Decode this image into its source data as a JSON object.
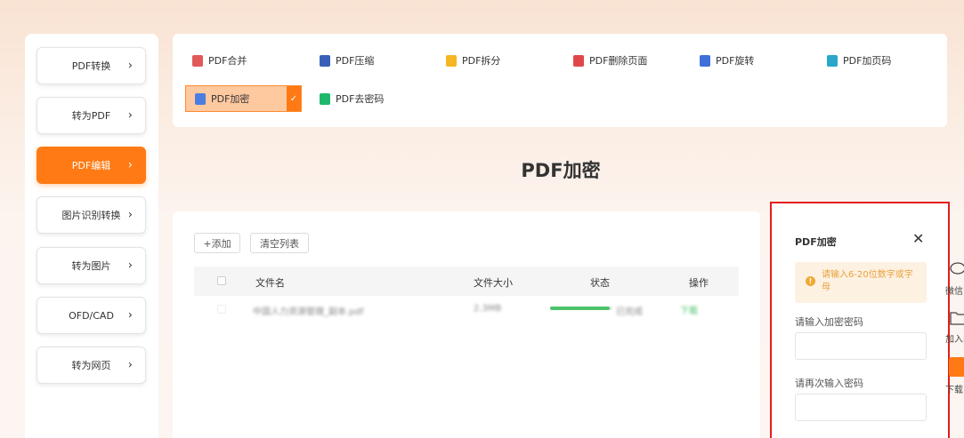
{
  "sidebar": {
    "items": [
      {
        "label": "PDF转换"
      },
      {
        "label": "转为PDF"
      },
      {
        "label": "PDF编辑",
        "active": true
      },
      {
        "label": "图片识别转换"
      },
      {
        "label": "转为图片"
      },
      {
        "label": "OFD/CAD"
      },
      {
        "label": "转为网页"
      }
    ],
    "chevron": "›"
  },
  "tools": {
    "items": [
      {
        "label": "PDF合并",
        "icon": "merge-icon",
        "color": "#e05a5a"
      },
      {
        "label": "PDF压缩",
        "icon": "compress-icon",
        "color": "#3a5fb8"
      },
      {
        "label": "PDF拆分",
        "icon": "split-icon",
        "color": "#f5b623"
      },
      {
        "label": "PDF删除页面",
        "icon": "delete-page-icon",
        "color": "#e04848"
      },
      {
        "label": "PDF旋转",
        "icon": "rotate-icon",
        "color": "#3f6fd8"
      },
      {
        "label": "PDF加页码",
        "icon": "page-number-icon",
        "color": "#2aa6c9"
      },
      {
        "label": "PDF加密",
        "icon": "lock-icon",
        "color": "#4c7de0",
        "selected": true
      },
      {
        "label": "PDF去密码",
        "icon": "unlock-icon",
        "color": "#1fb86b"
      }
    ],
    "check": "✓"
  },
  "main": {
    "title": "PDF加密",
    "add_label": "+添加",
    "clear_label": "清空列表",
    "columns": [
      "文件名",
      "文件大小",
      "状态",
      "操作"
    ],
    "row": {
      "filename": "中国人力资源管理_副本.pdf",
      "size": "2.3MB",
      "status": "已完成",
      "progress_fraction": 0.95,
      "action": "下载"
    }
  },
  "panel": {
    "title": "PDF加密",
    "close": "✕",
    "hint_icon": "!",
    "hint": "请输入6-20位数字或字母",
    "password_label": "请输入加密密码",
    "confirm_label": "请再次输入密码",
    "password_value": "",
    "confirm_value": ""
  },
  "floating": {
    "wechat": "微信",
    "favorite": "加入收",
    "download": "下载"
  },
  "colors": {
    "accent": "#ff7a14",
    "highlight_border": "#e51c1c",
    "progress": "#4cc36b"
  }
}
